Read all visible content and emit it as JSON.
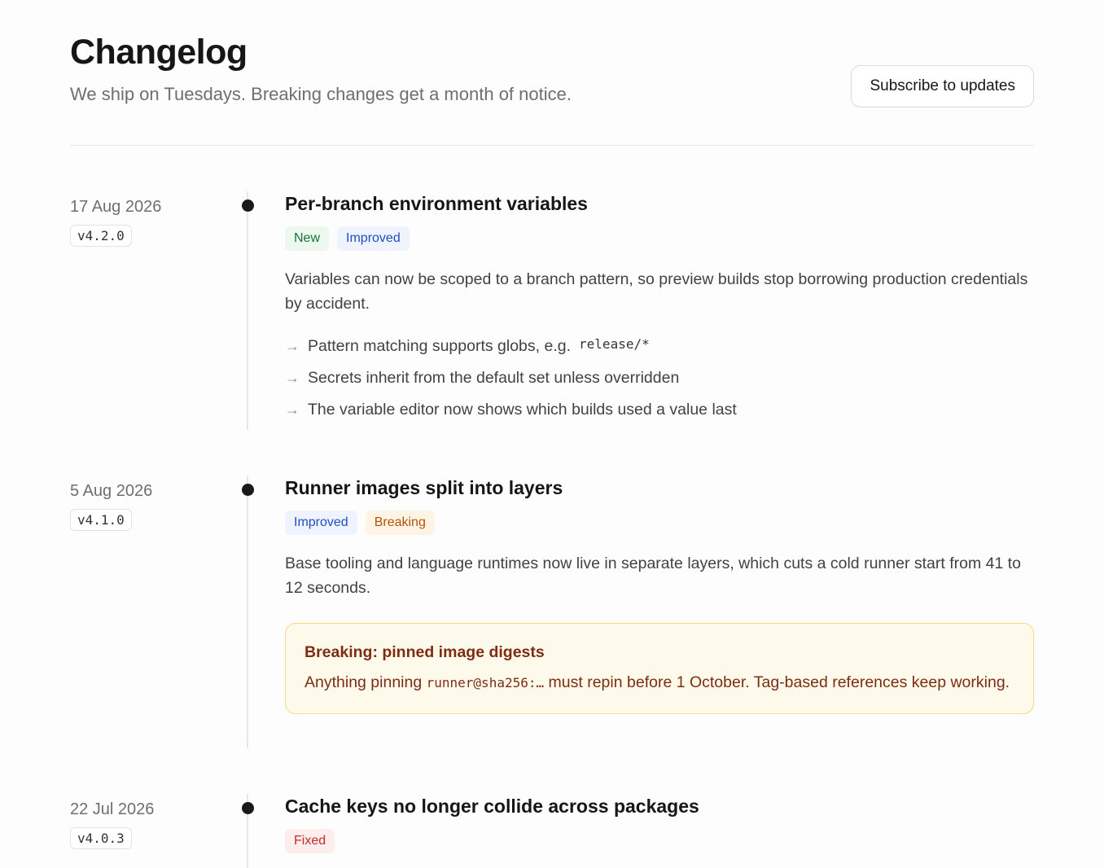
{
  "header": {
    "title": "Changelog",
    "subtitle": "We ship on Tuesdays. Breaking changes get a month of notice.",
    "subscribe_label": "Subscribe to updates"
  },
  "entries": [
    {
      "date": "17 Aug 2026",
      "version": "v4.2.0",
      "title": "Per-branch environment variables",
      "tags": [
        "New",
        "Improved"
      ],
      "description": "Variables can now be scoped to a branch pattern, so preview builds stop borrowing production credentials by accident.",
      "bullets": [
        {
          "text": "Pattern matching supports globs, e.g.",
          "code": "release/*"
        },
        {
          "text": "Secrets inherit from the default set unless overridden"
        },
        {
          "text": "The variable editor now shows which builds used a value last"
        }
      ]
    },
    {
      "date": "5 Aug 2026",
      "version": "v4.1.0",
      "title": "Runner images split into layers",
      "tags": [
        "Improved",
        "Breaking"
      ],
      "description": "Base tooling and language runtimes now live in separate layers, which cuts a cold runner start from 41 to 12 seconds.",
      "callout": {
        "title": "Breaking: pinned image digests",
        "text_before": "Anything pinning",
        "code": "runner@sha256:…",
        "text_after": "must repin before 1 October. Tag-based references keep working."
      }
    },
    {
      "date": "22 Jul 2026",
      "version": "v4.0.3",
      "title": "Cache keys no longer collide across packages",
      "tags": [
        "Fixed"
      ]
    }
  ],
  "colors": {
    "new": "#16753a",
    "improved": "#1f4fc4",
    "breaking": "#b45309",
    "fixed": "#c42b2b",
    "callout_border": "#f6dc83",
    "callout_bg": "#fefaeb"
  },
  "icons": {
    "bullet": "arrow-right-icon",
    "timeline": "timeline-dot-icon"
  }
}
